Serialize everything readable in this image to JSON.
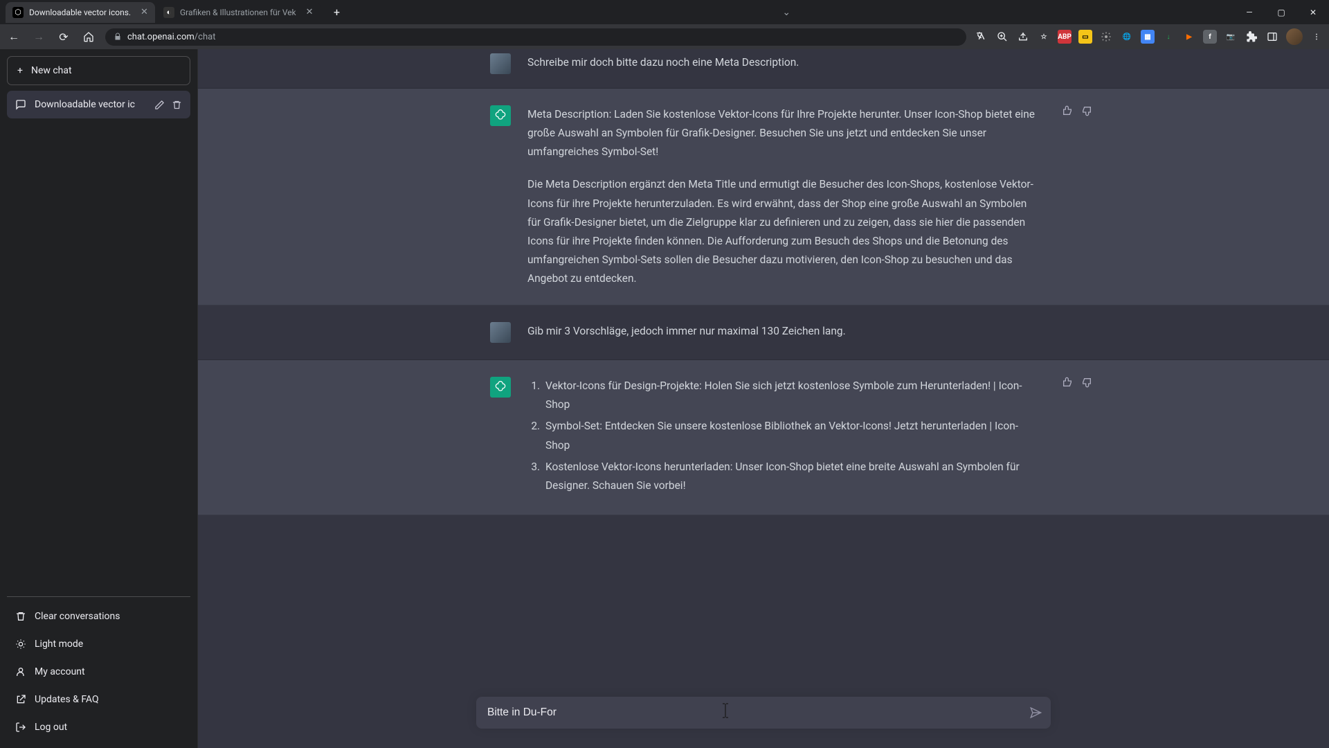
{
  "browser": {
    "tabs": [
      {
        "favicon": "⬡",
        "title": "Downloadable vector icons."
      },
      {
        "favicon": "◐",
        "title": "Grafiken & Illustrationen für Vek"
      }
    ],
    "url_host": "chat.openai.com",
    "url_path": "/chat"
  },
  "sidebar": {
    "new_chat": "New chat",
    "conversations": [
      {
        "title": "Downloadable vector ic"
      }
    ],
    "footer": {
      "clear": "Clear conversations",
      "light": "Light mode",
      "account": "My account",
      "updates": "Updates & FAQ",
      "logout": "Log out"
    }
  },
  "chat": {
    "m1": {
      "text": "Schreibe mir doch bitte dazu noch eine Meta Description."
    },
    "m2": {
      "p1": "Meta Description: Laden Sie kostenlose Vektor-Icons für Ihre Projekte herunter. Unser Icon-Shop bietet eine große Auswahl an Symbolen für Grafik-Designer. Besuchen Sie uns jetzt und entdecken Sie unser umfangreiches Symbol-Set!",
      "p2": "Die Meta Description ergänzt den Meta Title und ermutigt die Besucher des Icon-Shops, kostenlose Vektor-Icons für ihre Projekte herunterzuladen. Es wird erwähnt, dass der Shop eine große Auswahl an Symbolen für Grafik-Designer bietet, um die Zielgruppe klar zu definieren und zu zeigen, dass sie hier die passenden Icons für ihre Projekte finden können. Die Aufforderung zum Besuch des Shops und die Betonung des umfangreichen Symbol-Sets sollen die Besucher dazu motivieren, den Icon-Shop zu besuchen und das Angebot zu entdecken."
    },
    "m3": {
      "text": "Gib mir 3 Vorschläge, jedoch immer nur maximal 130 Zeichen lang."
    },
    "m4": {
      "i1": "Vektor-Icons für Design-Projekte: Holen Sie sich jetzt kostenlose Symbole zum Herunterladen! | Icon-Shop",
      "i2": "Symbol-Set: Entdecken Sie unsere kostenlose Bibliothek an Vektor-Icons! Jetzt herunterladen | Icon-Shop",
      "i3": "Kostenlose Vektor-Icons herunterladen: Unser Icon-Shop bietet eine breite Auswahl an Symbolen für Designer. Schauen Sie vorbei!"
    }
  },
  "input": {
    "value": "Bitte in Du-For"
  }
}
